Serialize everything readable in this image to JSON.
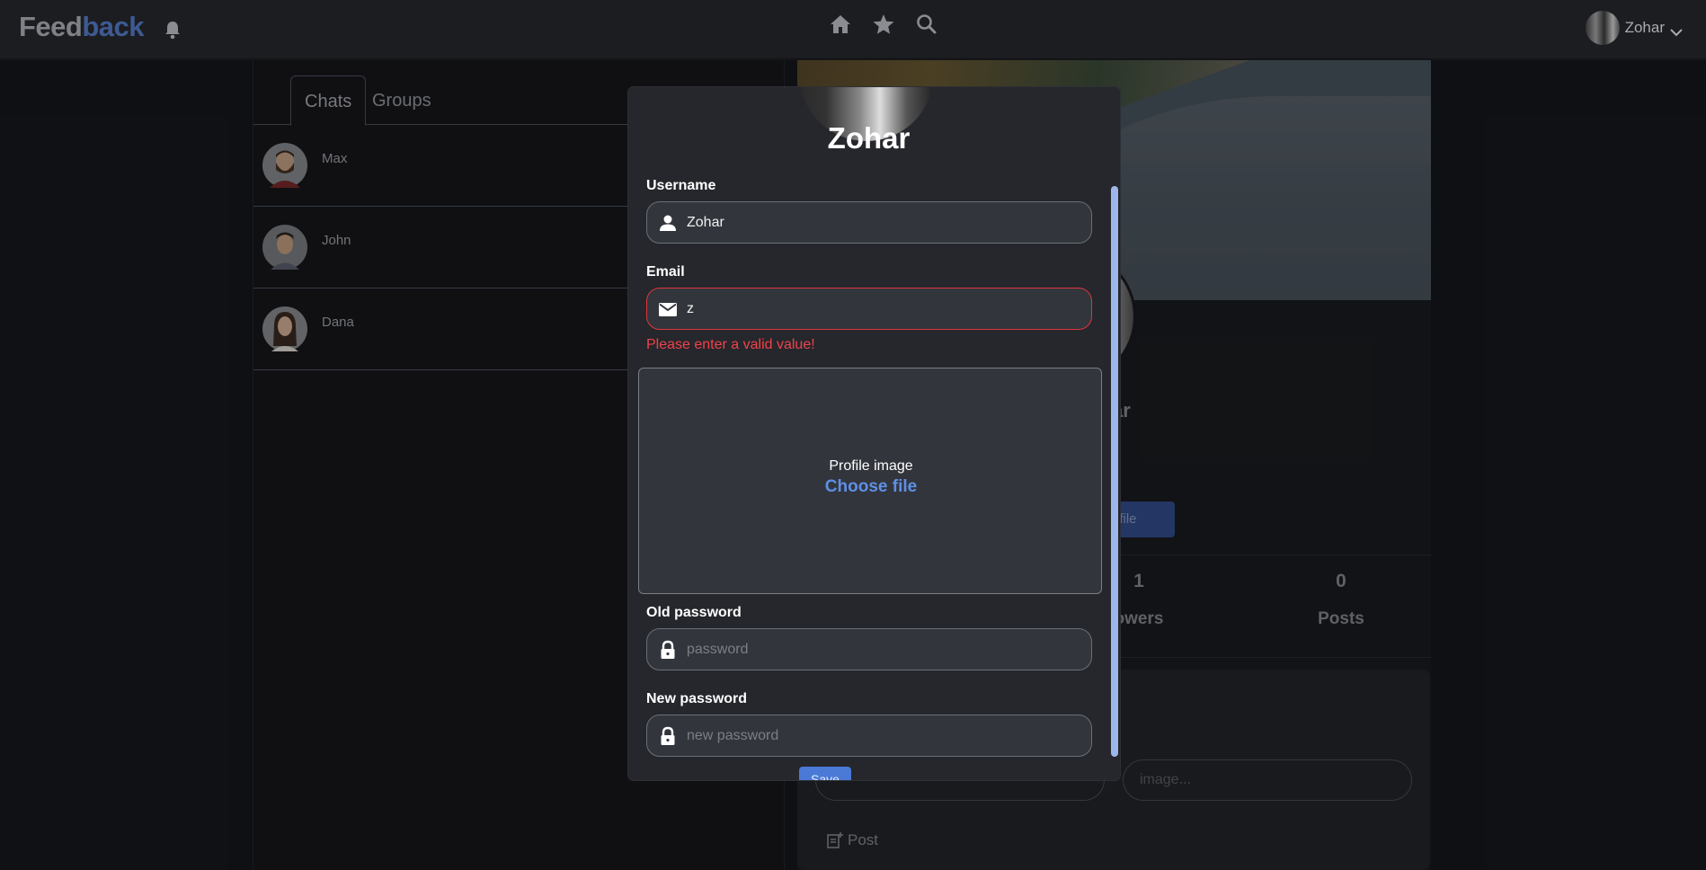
{
  "app": {
    "brand_part1": "Feed",
    "brand_part2": "back",
    "user_name": "Zohar"
  },
  "nav_icons": [
    "home-icon",
    "star-icon",
    "search-icon"
  ],
  "tabs": [
    {
      "label": "Chats",
      "active": true
    },
    {
      "label": "Groups",
      "active": false
    }
  ],
  "chats": [
    {
      "name": "Max"
    },
    {
      "name": "John"
    },
    {
      "name": "Dana"
    }
  ],
  "profile": {
    "name_fragment": "ar",
    "edit_button_fragment": "ofile",
    "stats": [
      {
        "value": "1",
        "label": "owers"
      },
      {
        "value": "0",
        "label": "Posts"
      }
    ],
    "post_image_placeholder": "image...",
    "post_button": "Post"
  },
  "modal": {
    "title": "Zohar",
    "username_label": "Username",
    "username_value": "Zohar",
    "email_label": "Email",
    "email_value": "z",
    "email_error": "Please enter a valid value!",
    "profile_image_label": "Profile image",
    "choose_file": "Choose file",
    "old_password_label": "Old password",
    "old_password_placeholder": "password",
    "new_password_label": "New password",
    "new_password_placeholder": "new password",
    "save_button": "Save"
  },
  "colors": {
    "background": "#16181c",
    "accent": "#4a79d6",
    "error": "#f0424a",
    "brand_back": "#3e5a93"
  }
}
